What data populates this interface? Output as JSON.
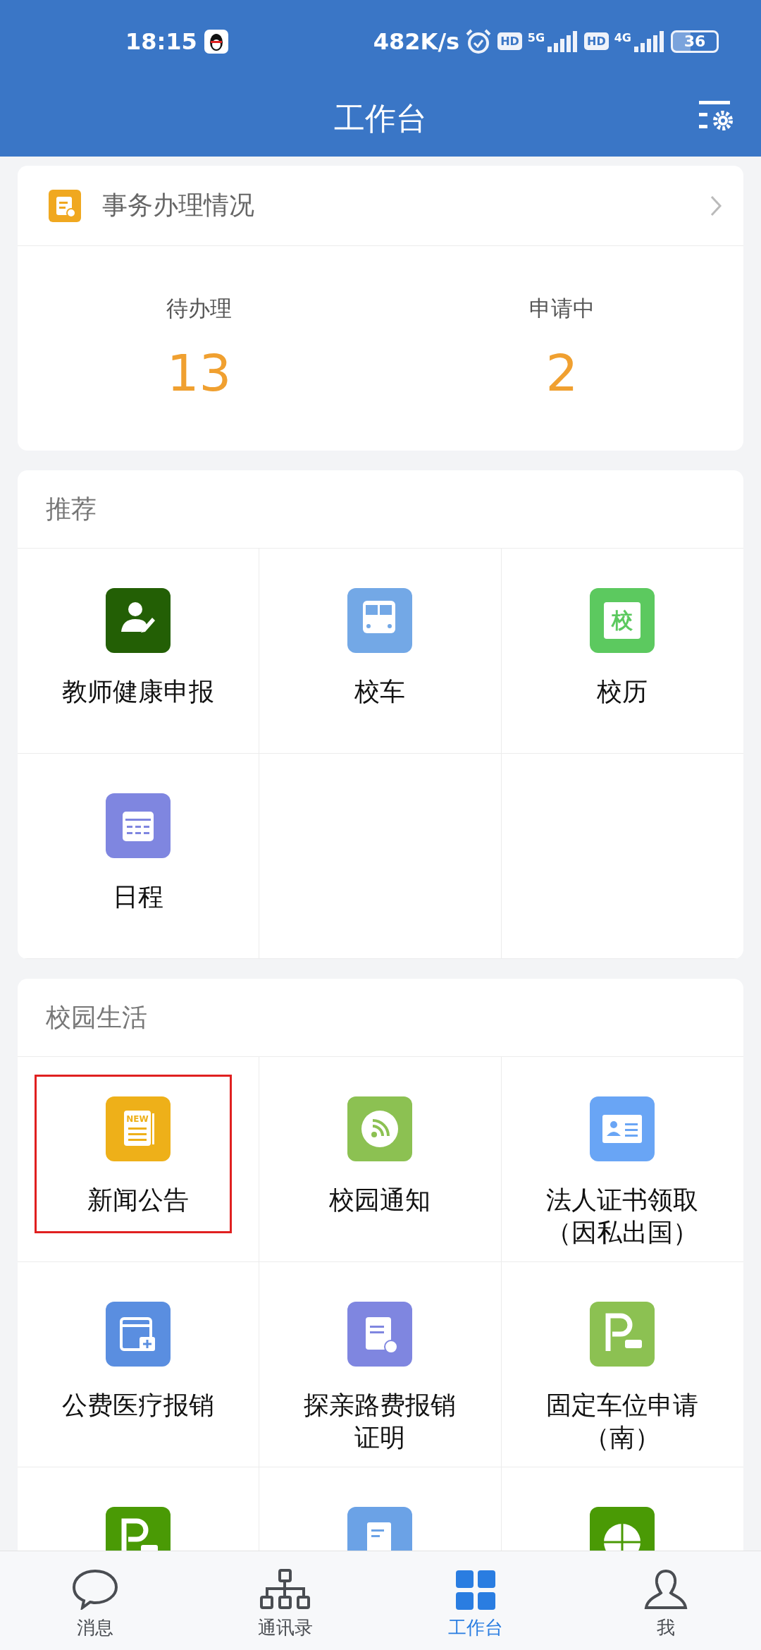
{
  "status_bar": {
    "time": "18:15",
    "speed": "482K/s",
    "hd_badges": [
      "HD",
      "HD"
    ],
    "networks": [
      "5G",
      "4G"
    ],
    "battery": "36"
  },
  "header": {
    "title": "工作台"
  },
  "affairs": {
    "title": "事务办理情况",
    "stats": [
      {
        "label": "待办理",
        "value": "13"
      },
      {
        "label": "申请中",
        "value": "2"
      }
    ]
  },
  "sections": [
    {
      "title": "推荐",
      "items": [
        {
          "kind": "teacher",
          "color": "#235f05",
          "label": "教师健康申报",
          "selected": false
        },
        {
          "kind": "bus",
          "color": "#73a8e6",
          "label": "校车",
          "selected": false
        },
        {
          "kind": "school-calendar",
          "color": "#5cc95f",
          "glyph": "校",
          "label": "校历",
          "selected": false
        },
        {
          "kind": "schedule",
          "color": "#7f86e0",
          "label": "日程",
          "selected": false
        }
      ]
    },
    {
      "title": "校园生活",
      "items": [
        {
          "kind": "news",
          "color": "#eeb019",
          "glyph": "NEW",
          "label": "新闻公告",
          "selected": true
        },
        {
          "kind": "rss",
          "color": "#8cc152",
          "label": "校园通知",
          "selected": false
        },
        {
          "kind": "id-card",
          "color": "#69a5f5",
          "label": "法人证书领取（因私出国）",
          "selected": false
        },
        {
          "kind": "medical",
          "color": "#5a8ee0",
          "label": "公费医疗报销",
          "selected": false
        },
        {
          "kind": "expense",
          "color": "#7f86e0",
          "label": "探亲路费报销证明",
          "selected": false
        },
        {
          "kind": "parking",
          "color": "#8cc152",
          "label": "固定车位申请（南）",
          "selected": false
        },
        {
          "kind": "parking",
          "color": "#4a9a05",
          "selected": false
        },
        {
          "kind": "document",
          "color": "#6ba2e6",
          "selected": false
        },
        {
          "kind": "globe",
          "color": "#4a9a05",
          "selected": false
        }
      ]
    }
  ],
  "tabs": [
    {
      "kind": "chat",
      "label": "消息",
      "selected": false
    },
    {
      "kind": "org",
      "label": "通讯录",
      "selected": false
    },
    {
      "kind": "grid",
      "label": "工作台",
      "selected": true
    },
    {
      "kind": "person",
      "label": "我",
      "selected": false
    }
  ]
}
